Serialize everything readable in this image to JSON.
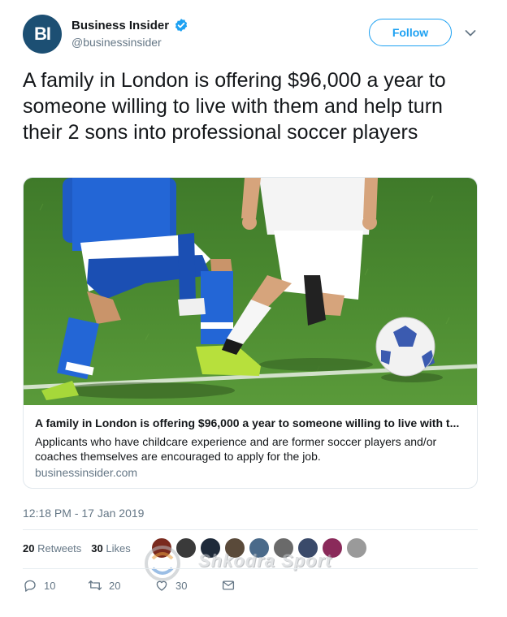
{
  "account": {
    "avatar_text": "BI",
    "display_name": "Business Insider",
    "handle": "@businessinsider",
    "verified_icon": "verified-badge-icon",
    "avatar_color": "#1c4f73"
  },
  "follow_label": "Follow",
  "tweet_text": "A family in London is offering $96,000 a year to someone willing to live with them and help turn their 2 sons into professional soccer players",
  "card": {
    "image_desc": "children playing soccer on a grass field",
    "title": "A family in London is offering $96,000 a year to someone willing to live with t...",
    "description": "Applicants who have childcare experience and are former soccer players and/or coaches themselves are encouraged to apply for the job.",
    "domain": "businessinsider.com"
  },
  "timestamp": "12:18 PM - 17 Jan 2019",
  "stats": {
    "retweets_count": "20",
    "retweets_label": "Retweets",
    "likes_count": "30",
    "likes_label": "Likes"
  },
  "watermark": "Shkodra Sport",
  "actions": {
    "reply_count": "10",
    "retweet_count": "20",
    "like_count": "30"
  },
  "colors": {
    "accent": "#1da1f2",
    "muted": "#657786",
    "text": "#14171a"
  }
}
